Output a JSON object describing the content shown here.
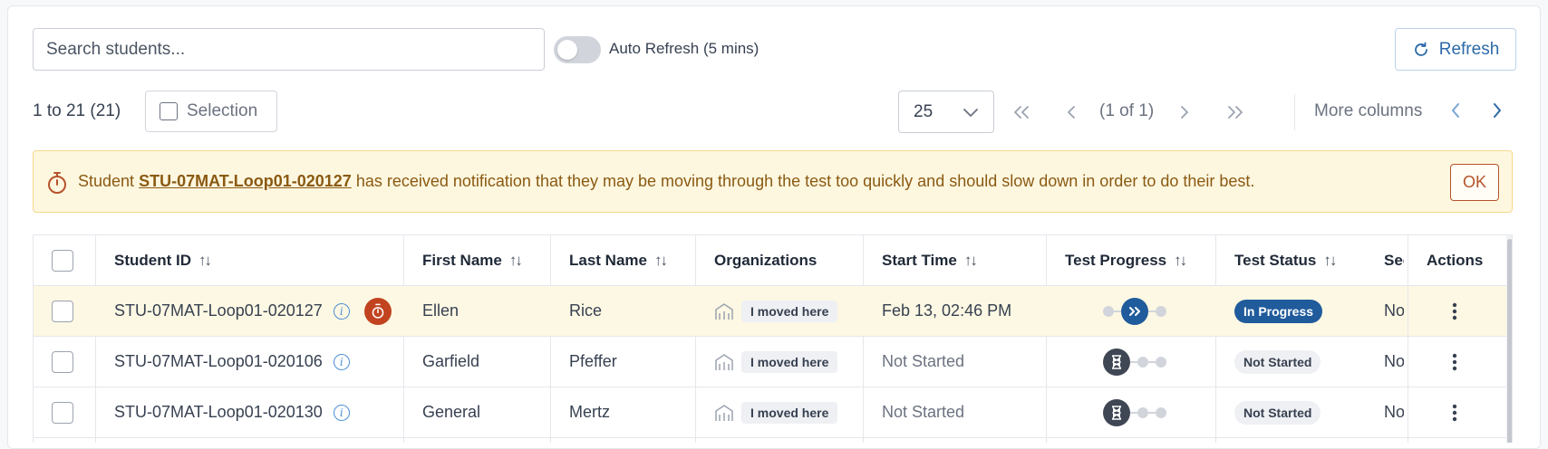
{
  "toolbar": {
    "search_placeholder": "Search students...",
    "auto_refresh_label": "Auto Refresh (5 mins)",
    "auto_refresh_on": false,
    "refresh_label": "Refresh"
  },
  "pagination": {
    "range_text": "1 to 21 (21)",
    "selection_label": "Selection",
    "page_size": "25",
    "first": "<<",
    "prev": "<",
    "page_text": "(1 of 1)",
    "next": ">",
    "last": ">>",
    "more_columns": "More columns"
  },
  "banner": {
    "prefix": "Student",
    "student_id": "STU-07MAT-Loop01-020127",
    "message": "has received notification that they may be moving through the test too quickly and should slow down in order to do their best.",
    "ok_label": "OK"
  },
  "table": {
    "headers": {
      "student_id": "Student ID",
      "first_name": "First Name",
      "last_name": "Last Name",
      "organizations": "Organizations",
      "start_time": "Start Time",
      "test_progress": "Test Progress",
      "test_status": "Test Status",
      "sec": "Sec",
      "actions": "Actions"
    },
    "rows": [
      {
        "student_id": "STU-07MAT-Loop01-020127",
        "first_name": "Ellen",
        "last_name": "Rice",
        "organization": "I moved here",
        "start_time": "Feb 13, 02:46 PM",
        "progress": "in-progress",
        "status": "In Progress",
        "sec": "Nor",
        "flagged": true
      },
      {
        "student_id": "STU-07MAT-Loop01-020106",
        "first_name": "Garfield",
        "last_name": "Pfeffer",
        "organization": "I moved here",
        "start_time": "Not Started",
        "progress": "not-started",
        "status": "Not Started",
        "sec": "Nor",
        "flagged": false
      },
      {
        "student_id": "STU-07MAT-Loop01-020130",
        "first_name": "General",
        "last_name": "Mertz",
        "organization": "I moved here",
        "start_time": "Not Started",
        "progress": "not-started",
        "status": "Not Started",
        "sec": "Nor",
        "flagged": false
      }
    ]
  },
  "colors": {
    "accent": "#2c6aa8",
    "banner_bg": "#fef7e0",
    "banner_text": "#8a5a12",
    "alert": "#c2431f",
    "pill_in_progress": "#205b9c"
  },
  "icons": {
    "refresh": "refresh-icon",
    "timer": "stopwatch-icon",
    "info": "info-icon",
    "org": "building-icon",
    "actions": "kebab-icon"
  }
}
